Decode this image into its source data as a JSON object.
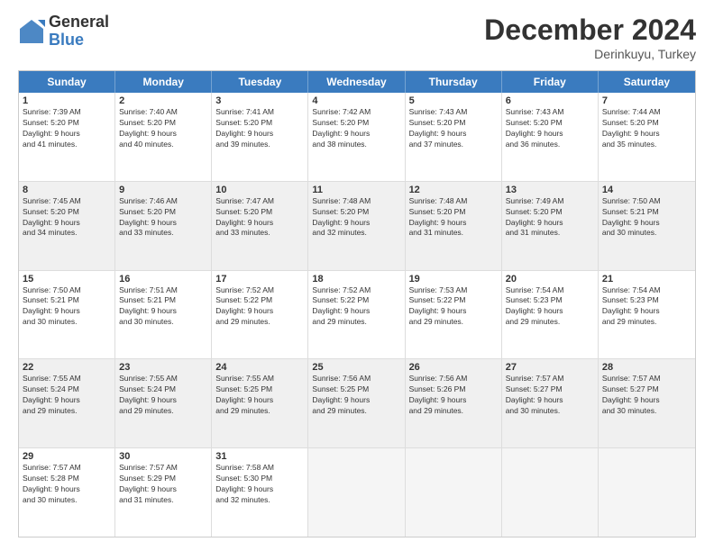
{
  "logo": {
    "general": "General",
    "blue": "Blue"
  },
  "header": {
    "month": "December 2024",
    "location": "Derinkuyu, Turkey"
  },
  "weekdays": [
    "Sunday",
    "Monday",
    "Tuesday",
    "Wednesday",
    "Thursday",
    "Friday",
    "Saturday"
  ],
  "rows": [
    [
      {
        "day": "1",
        "info": "Sunrise: 7:39 AM\nSunset: 5:20 PM\nDaylight: 9 hours\nand 41 minutes."
      },
      {
        "day": "2",
        "info": "Sunrise: 7:40 AM\nSunset: 5:20 PM\nDaylight: 9 hours\nand 40 minutes."
      },
      {
        "day": "3",
        "info": "Sunrise: 7:41 AM\nSunset: 5:20 PM\nDaylight: 9 hours\nand 39 minutes."
      },
      {
        "day": "4",
        "info": "Sunrise: 7:42 AM\nSunset: 5:20 PM\nDaylight: 9 hours\nand 38 minutes."
      },
      {
        "day": "5",
        "info": "Sunrise: 7:43 AM\nSunset: 5:20 PM\nDaylight: 9 hours\nand 37 minutes."
      },
      {
        "day": "6",
        "info": "Sunrise: 7:43 AM\nSunset: 5:20 PM\nDaylight: 9 hours\nand 36 minutes."
      },
      {
        "day": "7",
        "info": "Sunrise: 7:44 AM\nSunset: 5:20 PM\nDaylight: 9 hours\nand 35 minutes."
      }
    ],
    [
      {
        "day": "8",
        "info": "Sunrise: 7:45 AM\nSunset: 5:20 PM\nDaylight: 9 hours\nand 34 minutes."
      },
      {
        "day": "9",
        "info": "Sunrise: 7:46 AM\nSunset: 5:20 PM\nDaylight: 9 hours\nand 33 minutes."
      },
      {
        "day": "10",
        "info": "Sunrise: 7:47 AM\nSunset: 5:20 PM\nDaylight: 9 hours\nand 33 minutes."
      },
      {
        "day": "11",
        "info": "Sunrise: 7:48 AM\nSunset: 5:20 PM\nDaylight: 9 hours\nand 32 minutes."
      },
      {
        "day": "12",
        "info": "Sunrise: 7:48 AM\nSunset: 5:20 PM\nDaylight: 9 hours\nand 31 minutes."
      },
      {
        "day": "13",
        "info": "Sunrise: 7:49 AM\nSunset: 5:20 PM\nDaylight: 9 hours\nand 31 minutes."
      },
      {
        "day": "14",
        "info": "Sunrise: 7:50 AM\nSunset: 5:21 PM\nDaylight: 9 hours\nand 30 minutes."
      }
    ],
    [
      {
        "day": "15",
        "info": "Sunrise: 7:50 AM\nSunset: 5:21 PM\nDaylight: 9 hours\nand 30 minutes."
      },
      {
        "day": "16",
        "info": "Sunrise: 7:51 AM\nSunset: 5:21 PM\nDaylight: 9 hours\nand 30 minutes."
      },
      {
        "day": "17",
        "info": "Sunrise: 7:52 AM\nSunset: 5:22 PM\nDaylight: 9 hours\nand 29 minutes."
      },
      {
        "day": "18",
        "info": "Sunrise: 7:52 AM\nSunset: 5:22 PM\nDaylight: 9 hours\nand 29 minutes."
      },
      {
        "day": "19",
        "info": "Sunrise: 7:53 AM\nSunset: 5:22 PM\nDaylight: 9 hours\nand 29 minutes."
      },
      {
        "day": "20",
        "info": "Sunrise: 7:54 AM\nSunset: 5:23 PM\nDaylight: 9 hours\nand 29 minutes."
      },
      {
        "day": "21",
        "info": "Sunrise: 7:54 AM\nSunset: 5:23 PM\nDaylight: 9 hours\nand 29 minutes."
      }
    ],
    [
      {
        "day": "22",
        "info": "Sunrise: 7:55 AM\nSunset: 5:24 PM\nDaylight: 9 hours\nand 29 minutes."
      },
      {
        "day": "23",
        "info": "Sunrise: 7:55 AM\nSunset: 5:24 PM\nDaylight: 9 hours\nand 29 minutes."
      },
      {
        "day": "24",
        "info": "Sunrise: 7:55 AM\nSunset: 5:25 PM\nDaylight: 9 hours\nand 29 minutes."
      },
      {
        "day": "25",
        "info": "Sunrise: 7:56 AM\nSunset: 5:25 PM\nDaylight: 9 hours\nand 29 minutes."
      },
      {
        "day": "26",
        "info": "Sunrise: 7:56 AM\nSunset: 5:26 PM\nDaylight: 9 hours\nand 29 minutes."
      },
      {
        "day": "27",
        "info": "Sunrise: 7:57 AM\nSunset: 5:27 PM\nDaylight: 9 hours\nand 30 minutes."
      },
      {
        "day": "28",
        "info": "Sunrise: 7:57 AM\nSunset: 5:27 PM\nDaylight: 9 hours\nand 30 minutes."
      }
    ],
    [
      {
        "day": "29",
        "info": "Sunrise: 7:57 AM\nSunset: 5:28 PM\nDaylight: 9 hours\nand 30 minutes."
      },
      {
        "day": "30",
        "info": "Sunrise: 7:57 AM\nSunset: 5:29 PM\nDaylight: 9 hours\nand 31 minutes."
      },
      {
        "day": "31",
        "info": "Sunrise: 7:58 AM\nSunset: 5:30 PM\nDaylight: 9 hours\nand 32 minutes."
      },
      {
        "day": "",
        "info": "",
        "empty": true
      },
      {
        "day": "",
        "info": "",
        "empty": true
      },
      {
        "day": "",
        "info": "",
        "empty": true
      },
      {
        "day": "",
        "info": "",
        "empty": true
      }
    ]
  ]
}
